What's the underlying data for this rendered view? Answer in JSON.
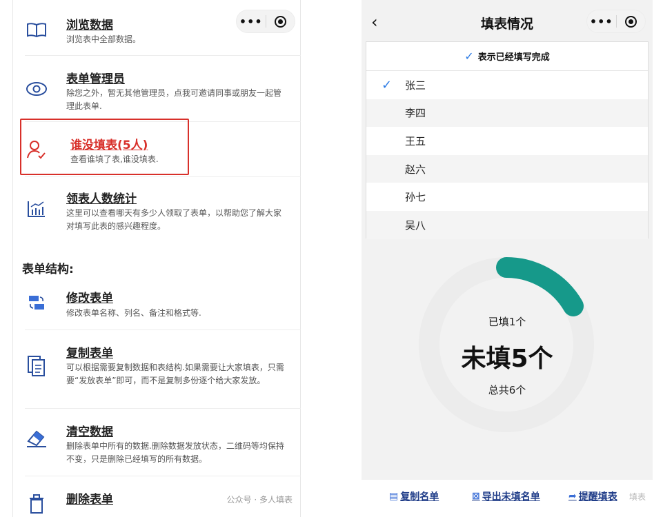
{
  "left": {
    "items": [
      {
        "title": "浏览数据",
        "desc": "浏览表中全部数据。"
      },
      {
        "title": "表单管理员",
        "desc": "除您之外，暂无其他管理员，点我可邀请同事或朋友一起管理此表单."
      },
      {
        "title": "谁没填表(5人)",
        "desc": "查看谁填了表,谁没填表."
      },
      {
        "title": "领表人数统计",
        "desc": "这里可以查看哪天有多少人领取了表单，以帮助您了解大家对填写此表的感兴趣程度。"
      },
      {
        "title": "修改表单",
        "desc": "修改表单名称、列名、备注和格式等."
      },
      {
        "title": "复制表单",
        "desc": "可以根据需要复制数据和表结构.如果需要让大家填表，只需要“发放表单”即可，而不是复制多份逐个给大家发放。"
      },
      {
        "title": "清空数据",
        "desc": "删除表单中所有的数据.删除数据发放状态，二维码等均保持不变，只是删除已经填写的所有数据。"
      },
      {
        "title": "删除表单",
        "desc": ""
      }
    ],
    "section_title": "表单结构:",
    "watermark": "公众号 · 多人填表",
    "capsule_more": "•••"
  },
  "right": {
    "nav_back": "‹",
    "nav_title": "填表情况",
    "capsule_more": "•••",
    "legend": "表示已经填写完成",
    "people": [
      {
        "name": "张三",
        "filled": true
      },
      {
        "name": "李四",
        "filled": false
      },
      {
        "name": "王五",
        "filled": false
      },
      {
        "name": "赵六",
        "filled": false
      },
      {
        "name": "孙七",
        "filled": false
      },
      {
        "name": "吴八",
        "filled": false
      }
    ],
    "filled_text": "已填1个",
    "unfilled_text": "未填5个",
    "total_text": "总共6个",
    "filled_count": 1,
    "total_count": 6,
    "colors": {
      "progress": "#16998a",
      "track": "#ececec",
      "check": "#2c7be5"
    },
    "bottom": {
      "copy_list": "复制名单",
      "export_unfilled": "导出未填名单",
      "remind": "提醒填表",
      "watermark": "填表"
    }
  }
}
